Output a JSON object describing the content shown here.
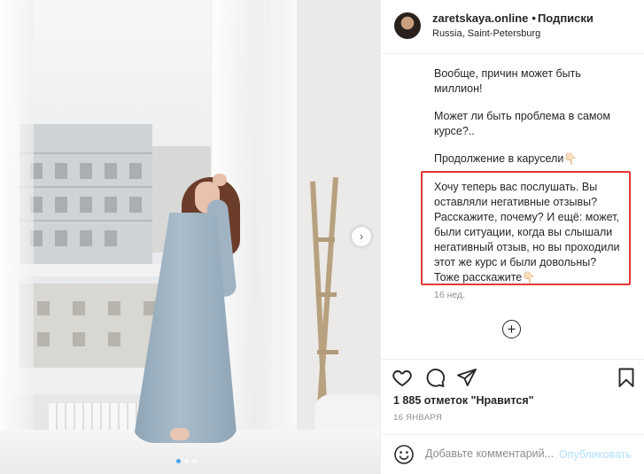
{
  "header": {
    "username": "zaretskaya.online",
    "separator": "•",
    "follow_label": "Подписки",
    "location": "Russia, Saint-Petersburg"
  },
  "comments": {
    "paragraphs": [
      "Вообще, причин может быть\nмиллион!",
      "Может ли быть проблема в самом\nкурсе?..",
      "Продолжение в карусели👇🏻",
      "Хочу теперь вас послушать. Вы\nоставляли негативные отзывы?\nРасскажите, почему? И ещё: может,\nбыли ситуации, когда вы слышали\nнегативный отзыв, но вы проходили\nэтот же курс и были довольны?\nТоже расскажите👇🏻"
    ],
    "time_ago": "16 нед.",
    "load_more_glyph": "+"
  },
  "photo": {
    "next_glyph": "›",
    "carousel_dots": 3,
    "active_dot": 0
  },
  "actions": {
    "likes": "1 885 отметок \"Нравится\"",
    "date": "16 ЯНВАРЯ",
    "icons": [
      "heart-icon",
      "comment-icon",
      "share-icon",
      "bookmark-icon"
    ]
  },
  "add_comment": {
    "placeholder": "Добавьте комментарий...",
    "publish_label": "Опубликовать"
  },
  "colors": {
    "text": "#262626",
    "muted": "#8e8e8e",
    "highlight_border": "#e53935",
    "publish_disabled": "#b2dffc",
    "active_dot": "#4aa3f0"
  }
}
